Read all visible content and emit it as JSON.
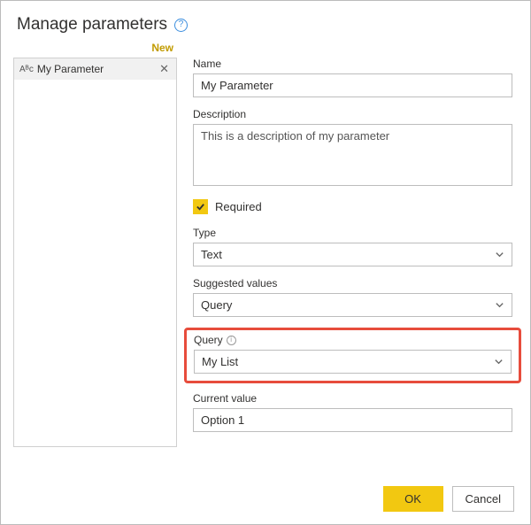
{
  "header": {
    "title": "Manage parameters"
  },
  "sidebar": {
    "new_label": "New",
    "items": [
      {
        "icon": "Aᴮc",
        "label": "My Parameter"
      }
    ]
  },
  "form": {
    "name_label": "Name",
    "name_value": "My Parameter",
    "description_label": "Description",
    "description_value": "This is a description of my parameter",
    "required_label": "Required",
    "required_checked": true,
    "type_label": "Type",
    "type_value": "Text",
    "suggested_label": "Suggested values",
    "suggested_value": "Query",
    "query_label": "Query",
    "query_value": "My List",
    "current_label": "Current value",
    "current_value": "Option 1"
  },
  "footer": {
    "ok_label": "OK",
    "cancel_label": "Cancel"
  }
}
